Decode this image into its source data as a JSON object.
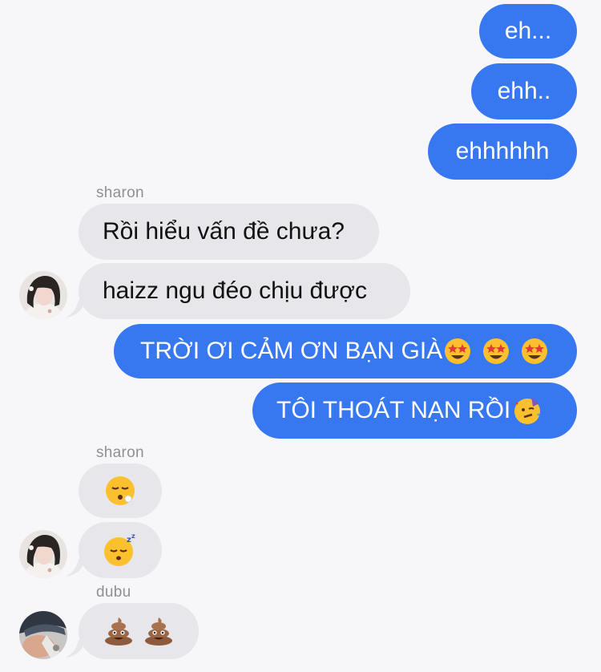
{
  "messages": [
    {
      "sender": "me",
      "text": "eh..."
    },
    {
      "sender": "me",
      "text": "ehh.."
    },
    {
      "sender": "me",
      "text": "ehhhhhh"
    }
  ],
  "group1": {
    "sender_name": "sharon",
    "msg1": "Rồi hiểu vấn đề chưa?",
    "msg2": "haizz ngu đéo chịu được"
  },
  "out2": {
    "msg1": "TRỜI ƠI CẢM ƠN BẠN GIÀ",
    "msg2": "TÔI THOÁT NẠN RỒI"
  },
  "group2": {
    "sender_name": "sharon"
  },
  "group3": {
    "sender_name": "dubu"
  },
  "emoji_names": {
    "star_struck": "star-struck-emoji",
    "partying": "partying-face-emoji",
    "exhale": "face-exhaling-emoji",
    "sleeping": "sleeping-face-emoji",
    "poop": "pile-of-poo-emoji"
  },
  "colors": {
    "outgoing_bubble": "#3778f1",
    "incoming_bubble": "#e6e6eb",
    "background": "#f7f7f9",
    "sender_label": "#8f8f94"
  }
}
